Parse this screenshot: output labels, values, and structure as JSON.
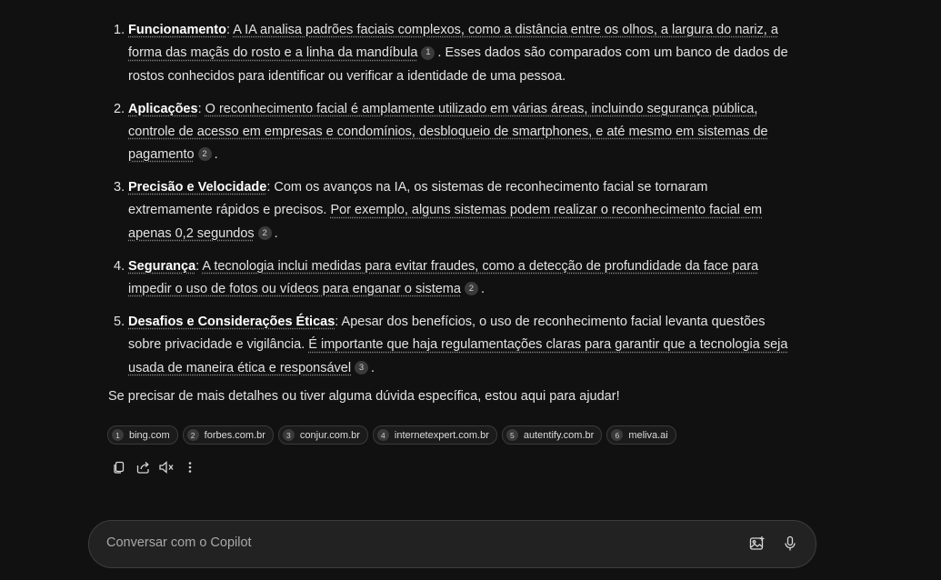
{
  "items": [
    {
      "num": "1.",
      "term": "Funcionamento",
      "lead": ": ",
      "cited_text": "A IA analisa padrões faciais complexos, como a distância entre os olhos, a largura do nariz, a forma das maçãs do rosto e a linha da mandíbula",
      "cite": "1",
      "tail": ". Esses dados são comparados com um banco de dados de rostos conhecidos para identificar ou verificar a identidade de uma pessoa."
    },
    {
      "num": "2.",
      "term": "Aplicações",
      "lead": ": ",
      "cited_text": "O reconhecimento facial é amplamente utilizado em várias áreas, incluindo segurança pública, controle de acesso em empresas e condomínios, desbloqueio de smartphones, e até mesmo em sistemas de pagamento",
      "cite": "2",
      "tail": "."
    },
    {
      "num": "3.",
      "term": "Precisão e Velocidade",
      "lead": ": Com os avanços na IA, os sistemas de reconhecimento facial se tornaram extremamente rápidos e precisos. ",
      "cited_text": "Por exemplo, alguns sistemas podem realizar o reconhecimento facial em apenas 0,2 segundos",
      "cite": "2",
      "tail": "."
    },
    {
      "num": "4.",
      "term": "Segurança",
      "lead": ": ",
      "cited_text": "A tecnologia inclui medidas para evitar fraudes, como a detecção de profundidade da face para impedir o uso de fotos ou vídeos para enganar o sistema",
      "cite": "2",
      "tail": "."
    },
    {
      "num": "5.",
      "term": "Desafios e Considerações Éticas",
      "lead": ": Apesar dos benefícios, o uso de reconhecimento facial levanta questões sobre privacidade e vigilância. ",
      "cited_text": "É importante que haja regulamentações claras para garantir que a tecnologia seja usada de maneira ética e responsável",
      "cite": "3",
      "tail": "."
    }
  ],
  "closing": "Se precisar de mais detalhes ou tiver alguma dúvida específica, estou aqui para ajudar!",
  "sources": [
    {
      "n": "1",
      "label": "bing.com"
    },
    {
      "n": "2",
      "label": "forbes.com.br"
    },
    {
      "n": "3",
      "label": "conjur.com.br"
    },
    {
      "n": "4",
      "label": "internetexpert.com.br"
    },
    {
      "n": "5",
      "label": "autentify.com.br"
    },
    {
      "n": "6",
      "label": "meliva.ai"
    }
  ],
  "actions": [
    "copy-icon",
    "share-icon",
    "read-aloud-icon",
    "more-options-icon"
  ],
  "composer": {
    "placeholder": "Conversar com o Copilot",
    "icons": [
      "image-upload-icon",
      "microphone-icon"
    ]
  },
  "colors": {
    "background": "#111111",
    "text": "#e3e3e3",
    "chip_bg": "#1b1b1b",
    "composer_bg": "#222222"
  }
}
